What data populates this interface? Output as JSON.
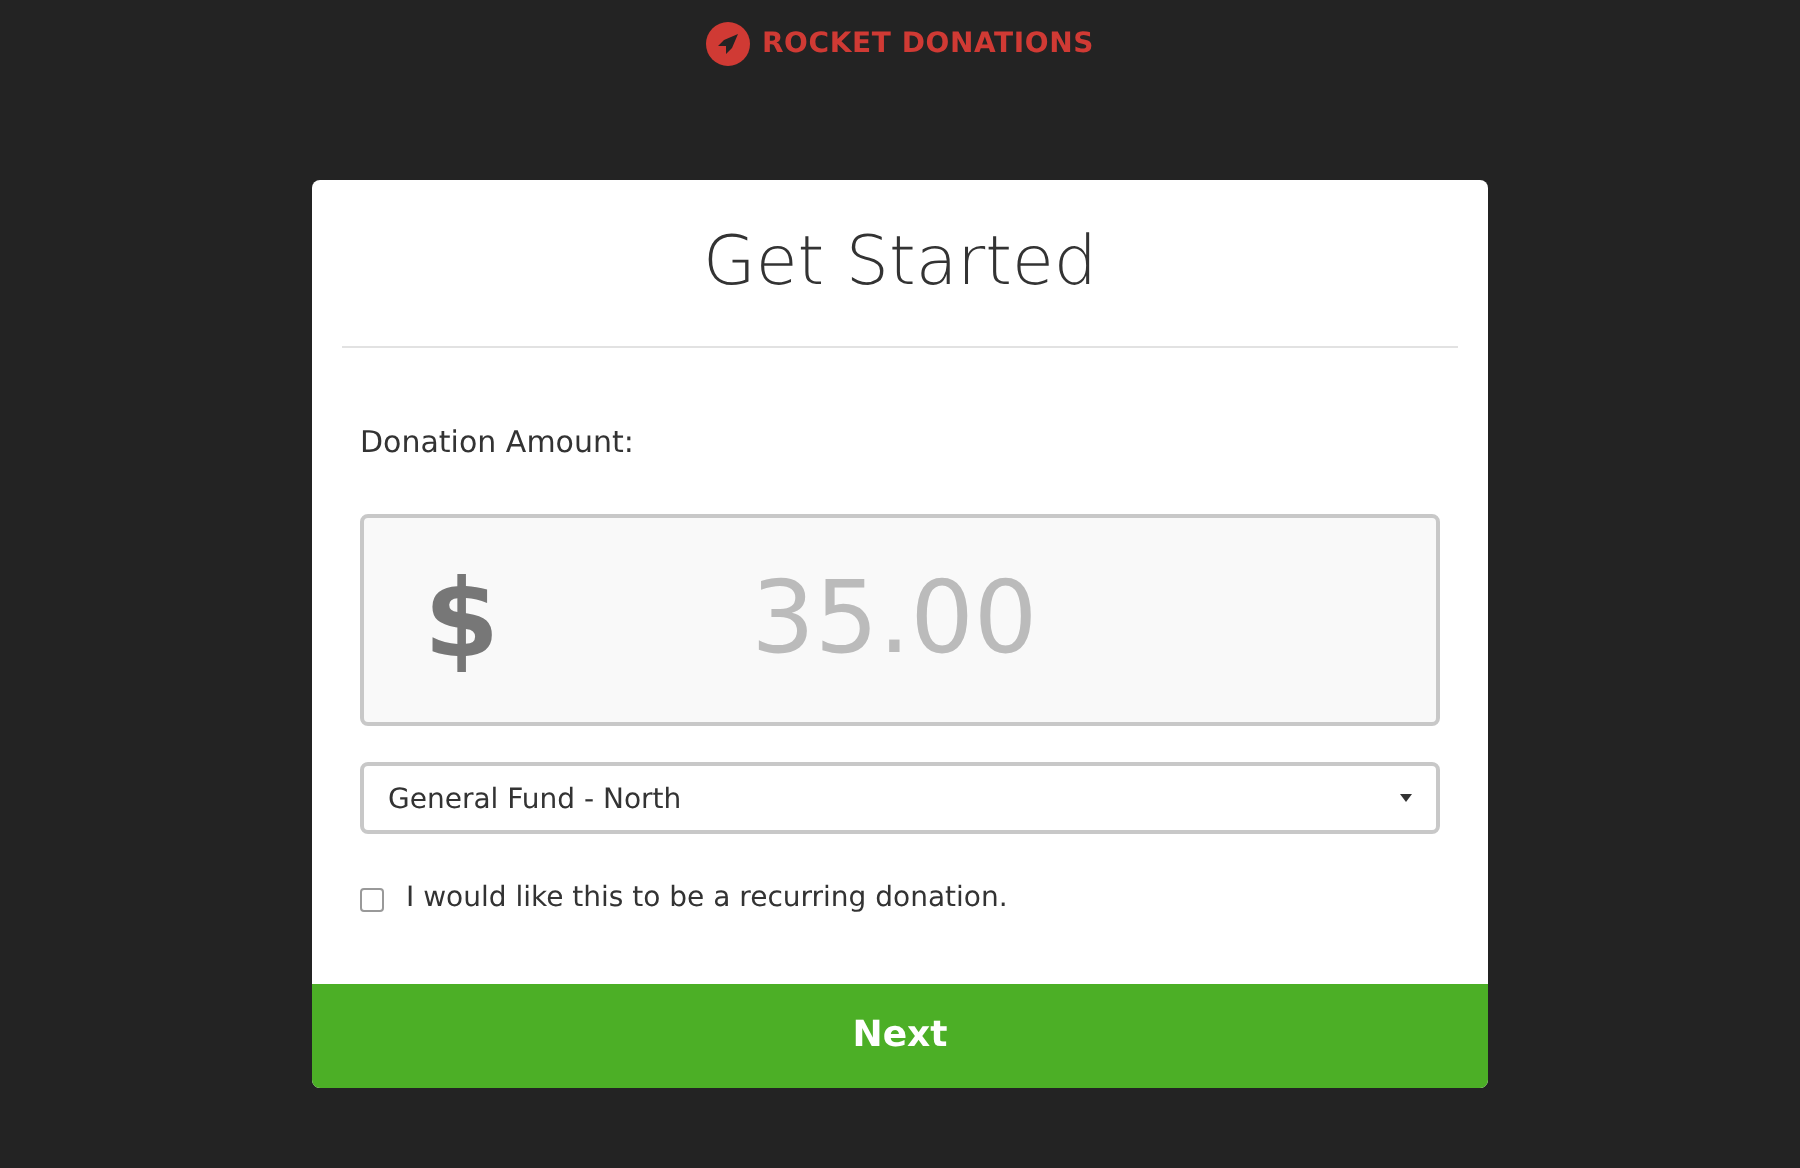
{
  "brand": {
    "name": "ROCKET DONATIONS"
  },
  "card": {
    "title": "Get Started",
    "amount_label": "Donation Amount:",
    "currency": "$",
    "amount": {
      "placeholder": "35.00"
    },
    "fund_select": {
      "value": "General Fund - North"
    },
    "recurring": {
      "label": "I would like this to be a recurring donation.",
      "checked": false
    },
    "next_button": "Next"
  }
}
